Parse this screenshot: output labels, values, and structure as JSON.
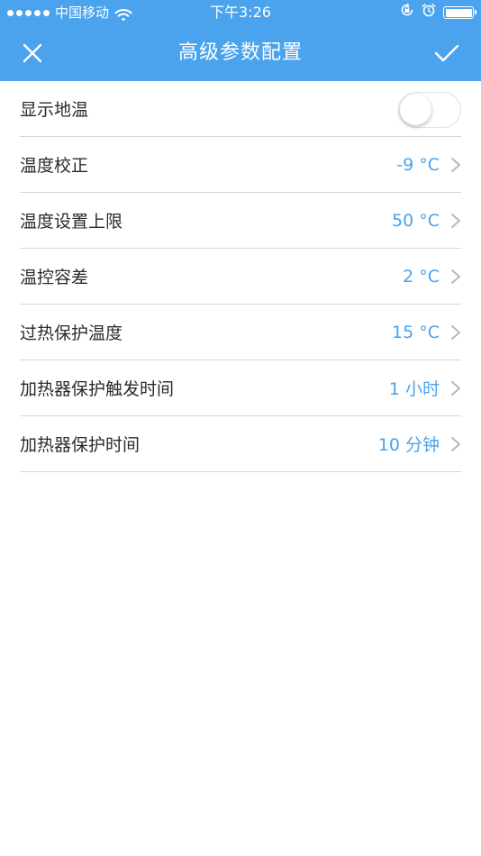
{
  "status_bar": {
    "carrier": "中国移动",
    "time": "下午3:26",
    "battery_level": 1.0
  },
  "nav": {
    "title": "高级参数配置"
  },
  "settings": [
    {
      "label": "显示地温",
      "type": "toggle",
      "on": false
    },
    {
      "label": "温度校正",
      "value": "-9 °C"
    },
    {
      "label": "温度设置上限",
      "value": "50 °C"
    },
    {
      "label": "温控容差",
      "value": "2 °C"
    },
    {
      "label": "过热保护温度",
      "value": "15 °C"
    },
    {
      "label": "加热器保护触发时间",
      "value": "1 小时"
    },
    {
      "label": "加热器保护时间",
      "value": "10 分钟"
    }
  ],
  "colors": {
    "accent": "#4aa3ec",
    "text": "#2b2b2b",
    "divider": "#d6d6d6"
  },
  "icons": {
    "close": "close-icon",
    "confirm": "check-icon",
    "chevron": "chevron-right-icon",
    "wifi": "wifi-icon",
    "battery": "battery-icon",
    "orientation_lock": "orientation-lock-icon",
    "alarm": "alarm-icon"
  }
}
